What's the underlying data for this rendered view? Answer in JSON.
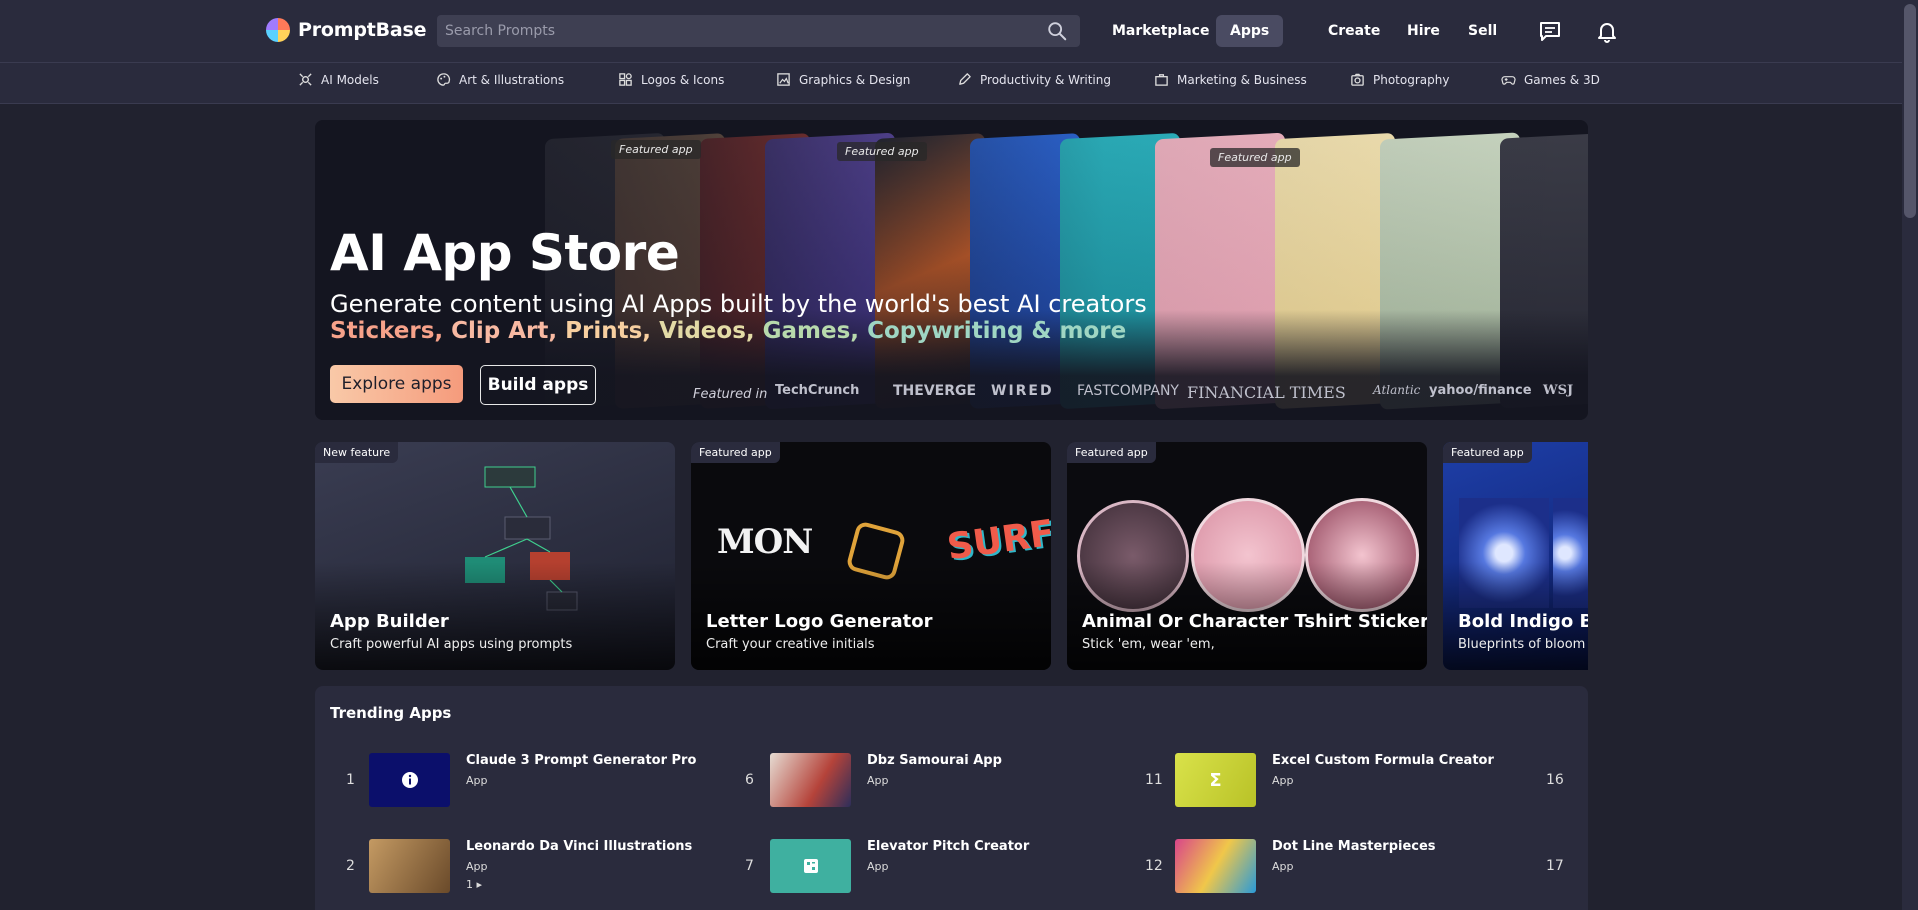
{
  "brand": {
    "name": "PromptBase"
  },
  "search": {
    "placeholder": "Search Prompts"
  },
  "nav": {
    "marketplace": "Marketplace",
    "apps": "Apps",
    "create": "Create",
    "hire": "Hire",
    "sell": "Sell"
  },
  "categories": [
    "AI Models",
    "Art & Illustrations",
    "Logos & Icons",
    "Graphics & Design",
    "Productivity & Writing",
    "Marketing & Business",
    "Photography",
    "Games & 3D"
  ],
  "hero": {
    "title": "AI App Store",
    "subtitle": "Generate content using AI Apps built by the world's best AI creators",
    "list": [
      "Stickers,",
      "Clip Art,",
      "Prints,",
      "Videos,",
      "Games,",
      "Copywriting & more"
    ],
    "list_colors": [
      "#f7a28a",
      "#f8b9a2",
      "#f7cfa0",
      "#e3dba6",
      "#b7d9ac",
      "#9fd6c3"
    ],
    "explore_label": "Explore apps",
    "build_label": "Build apps",
    "featured_in": "Featured in",
    "featured_tag": "Featured app",
    "press": [
      "TechCrunch",
      "THEVERGE",
      "WIRED",
      "FASTCOMPANY",
      "FINANCIAL TIMES",
      "Atlantic",
      "yahoo/finance",
      "WSJ"
    ]
  },
  "cards": [
    {
      "tag": "New feature",
      "title": "App Builder",
      "subtitle": "Craft powerful AI apps using prompts"
    },
    {
      "tag": "Featured app",
      "title": "Letter Logo Generator",
      "subtitle": "Craft your creative initials"
    },
    {
      "tag": "Featured app",
      "title": "Animal Or Character Tshirt Stickers",
      "subtitle": "Stick 'em, wear 'em,"
    },
    {
      "tag": "Featured app",
      "title": "Bold Indigo Bloo",
      "subtitle": "Blueprints of bloom b"
    }
  ],
  "trending": {
    "title": "Trending Apps",
    "items": [
      {
        "num": "1",
        "name": "Claude 3 Prompt Generator Pro",
        "kind": "App"
      },
      {
        "num": "2",
        "name": "Leonardo Da Vinci Illustrations",
        "kind": "App",
        "extra": "1 ▸"
      },
      {
        "num": "6",
        "name": "Dbz Samourai App",
        "kind": "App"
      },
      {
        "num": "7",
        "name": "Elevator Pitch Creator",
        "kind": "App"
      },
      {
        "num": "11",
        "name": "Excel Custom Formula Creator",
        "kind": "App"
      },
      {
        "num": "12",
        "name": "Dot Line Masterpieces",
        "kind": "App"
      },
      {
        "num": "16"
      },
      {
        "num": "17"
      }
    ]
  },
  "colors": {
    "bg": "#21222f",
    "bar": "#2a2b3d",
    "accent": "#f59b7c"
  }
}
